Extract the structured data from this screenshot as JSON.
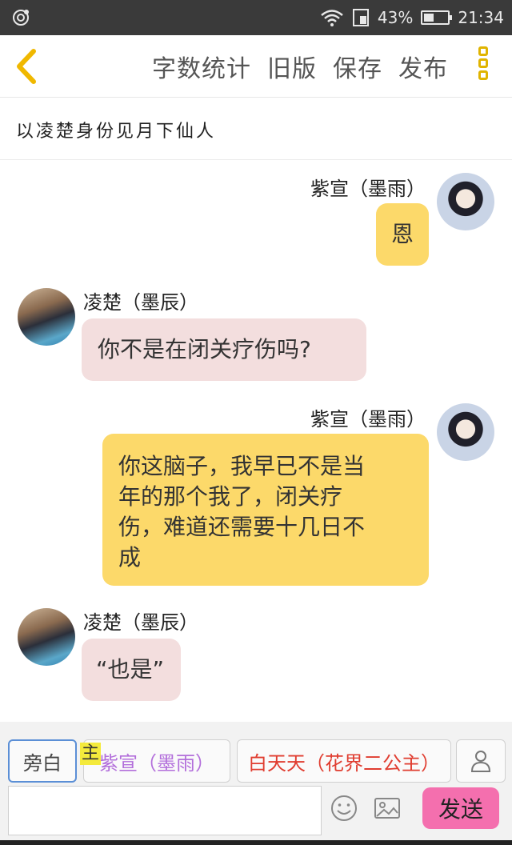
{
  "status_bar": {
    "battery_percent": "43%",
    "battery_level": 0.43,
    "time": "21:34"
  },
  "toolbar": {
    "word_count": "字数统计",
    "old_version": "旧版",
    "save": "保存",
    "publish": "发布"
  },
  "story": {
    "title": "以凌楚身份见月下仙人"
  },
  "messages": [
    {
      "speaker": "紫宣（墨雨）",
      "text": "恩",
      "side": "right"
    },
    {
      "speaker": "凌楚（墨辰）",
      "text": "你不是在闭关疗伤吗?",
      "side": "left"
    },
    {
      "speaker": "紫宣（墨雨）",
      "lines": [
        "你这脑子，我早已不是当",
        "年的那个我了，闭关疗",
        "伤，难道还需要十几日不",
        "成"
      ],
      "side": "right"
    },
    {
      "speaker": "凌楚（墨辰）",
      "text": "“也是”",
      "side": "left"
    }
  ],
  "roles": {
    "narration": "旁白",
    "main_tag": "主",
    "role1": "紫宣（墨雨）",
    "role2": "白天天（花界二公主）"
  },
  "input": {
    "placeholder": "",
    "send": "发送"
  },
  "colors": {
    "accent_yellow": "#fcd96a",
    "bubble_pink": "#f3dede",
    "send_pink": "#f46fae",
    "role1_purple": "#b36fdb",
    "role2_red": "#e03d30"
  }
}
